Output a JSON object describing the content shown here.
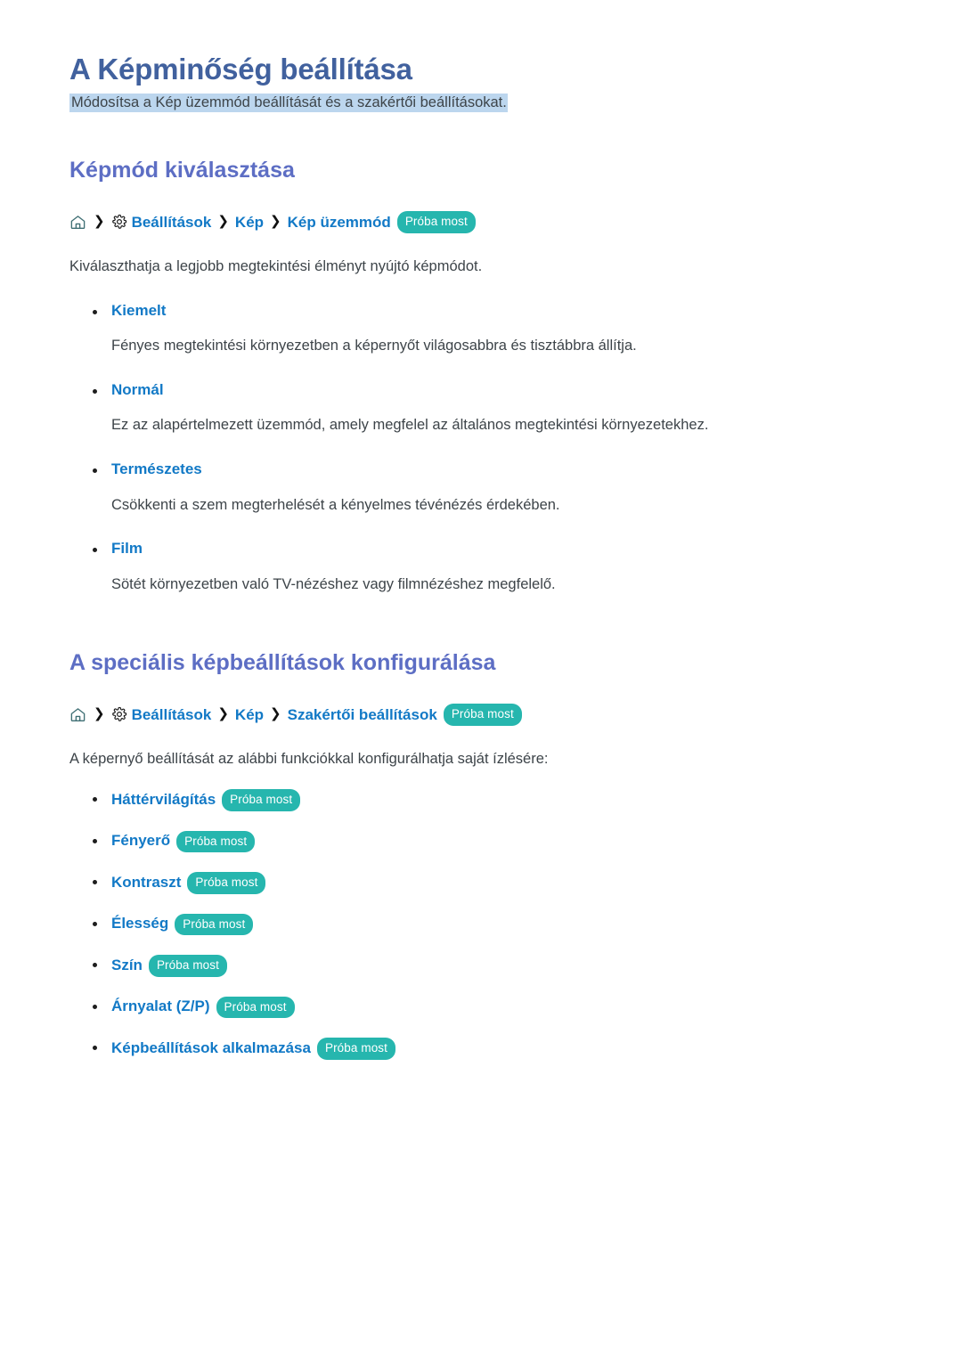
{
  "document": {
    "title": "A Képminőség beállítása",
    "subtitle": "Módosítsa a Kép üzemmód beállítását és a szakértői beállításokat."
  },
  "colors": {
    "title": "#41619e",
    "section_heading": "#5d6ec4",
    "link": "#1279c6",
    "badge_bg": "#26b6ae",
    "highlight": "#bcd6ee",
    "body_text": "#3d4449"
  },
  "sections": [
    {
      "heading": "Képmód kiválasztása",
      "breadcrumb": {
        "home_icon": "home-icon",
        "gear_icon": "gear-icon",
        "separator": "❯",
        "crumbs": [
          "Beállítások",
          "Kép",
          "Kép üzemmód"
        ],
        "badge": "Próba most"
      },
      "intro": "Kiválaszthatja a legjobb megtekintési élményt nyújtó képmódot.",
      "items": [
        {
          "term": "Kiemelt",
          "desc": "Fényes megtekintési környezetben a képernyőt világosabbra és tisztábbra állítja."
        },
        {
          "term": "Normál",
          "desc": "Ez az alapértelmezett üzemmód, amely megfelel az általános megtekintési környezetekhez."
        },
        {
          "term": "Természetes",
          "desc": "Csökkenti a szem megterhelését a kényelmes tévénézés érdekében."
        },
        {
          "term": "Film",
          "desc": "Sötét környezetben való TV-nézéshez vagy filmnézéshez megfelelő."
        }
      ]
    },
    {
      "heading": "A speciális képbeállítások konfigurálása",
      "breadcrumb": {
        "home_icon": "home-icon",
        "gear_icon": "gear-icon",
        "separator": "❯",
        "crumbs": [
          "Beállítások",
          "Kép",
          "Szakértői beállítások"
        ],
        "badge": "Próba most"
      },
      "intro": "A képernyő beállítását az alábbi funkciókkal konfigurálhatja saját ízlésére:",
      "features": [
        {
          "term": "Háttérvilágítás",
          "badge": "Próba most"
        },
        {
          "term": "Fényerő",
          "badge": "Próba most"
        },
        {
          "term": "Kontraszt",
          "badge": "Próba most"
        },
        {
          "term": "Élesség",
          "badge": "Próba most"
        },
        {
          "term": "Szín",
          "badge": "Próba most"
        },
        {
          "term": "Árnyalat (Z/P)",
          "badge": "Próba most"
        },
        {
          "term": "Képbeállítások alkalmazása",
          "badge": "Próba most"
        }
      ]
    }
  ]
}
